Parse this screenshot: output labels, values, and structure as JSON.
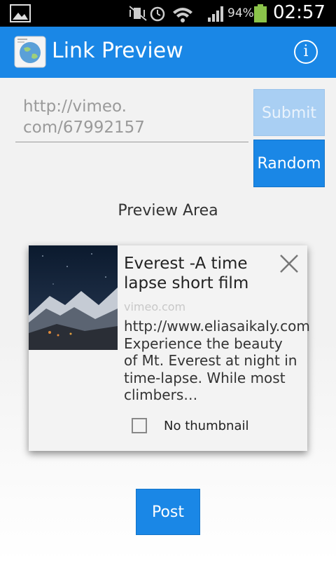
{
  "status_bar": {
    "battery_percent": "94%",
    "time": "02:57"
  },
  "action_bar": {
    "title": "Link Preview",
    "info_icon": "i"
  },
  "form": {
    "url_value": "http://vimeo.\ncom/67992157",
    "submit_label": "Submit",
    "random_label": "Random"
  },
  "preview": {
    "label": "Preview Area",
    "card": {
      "title": "Everest -A time lapse short film",
      "domain": "vimeo.com",
      "description": "http://www.eliasaikaly.com Experience the beauty of Mt. Everest at night in time-lapse. While most climbers…",
      "checkbox_label": "No thumbnail",
      "checkbox_checked": false
    }
  },
  "post_label": "Post",
  "colors": {
    "accent": "#1a87e6",
    "submit_disabled": "#a9cff3"
  }
}
